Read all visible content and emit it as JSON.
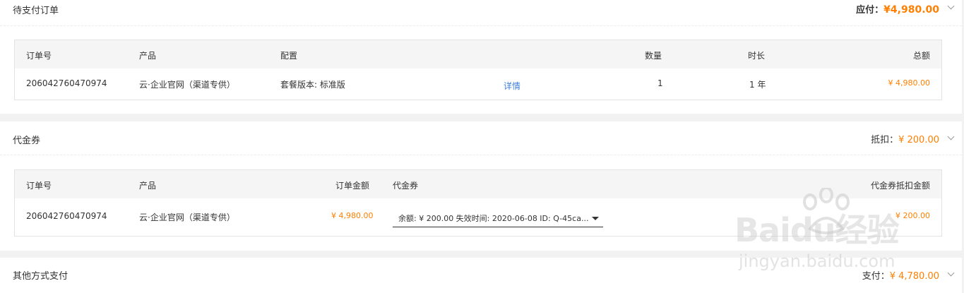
{
  "pending": {
    "title": "待支付订单",
    "due_label": "应付：",
    "due_amount": "¥4,980.00",
    "headers": {
      "order_no": "订单号",
      "product": "产品",
      "config": "配置",
      "qty": "数量",
      "duration": "时长",
      "total": "总额"
    },
    "row": {
      "order_no": "206042760470974",
      "product": "云·企业官网（渠道专供）",
      "config": "套餐版本: 标准版",
      "details": "详情",
      "qty": "1",
      "duration": "1 年",
      "total": "¥ 4,980.00"
    }
  },
  "voucher": {
    "title": "代金券",
    "deduct_label": "抵扣：",
    "deduct_amount": "¥ 200.00",
    "headers": {
      "order_no": "订单号",
      "product": "产品",
      "order_amount": "订单金额",
      "voucher": "代金券",
      "voucher_deduct": "代金券抵扣金额"
    },
    "row": {
      "order_no": "206042760470974",
      "product": "云·企业官网（渠道专供）",
      "order_amount": "¥ 4,980.00",
      "voucher_select": "余额: ¥ 200.00 失效时间: 2020-06-08 ID: Q-45ca...",
      "voucher_deduct": "¥ 200.00"
    }
  },
  "other": {
    "title": "其他方式支付",
    "pay_label": "支付：",
    "pay_amount": "¥ 4,780.00"
  },
  "watermark": {
    "brand": "Baidu经验",
    "url": "jingyan.baidu.com"
  }
}
